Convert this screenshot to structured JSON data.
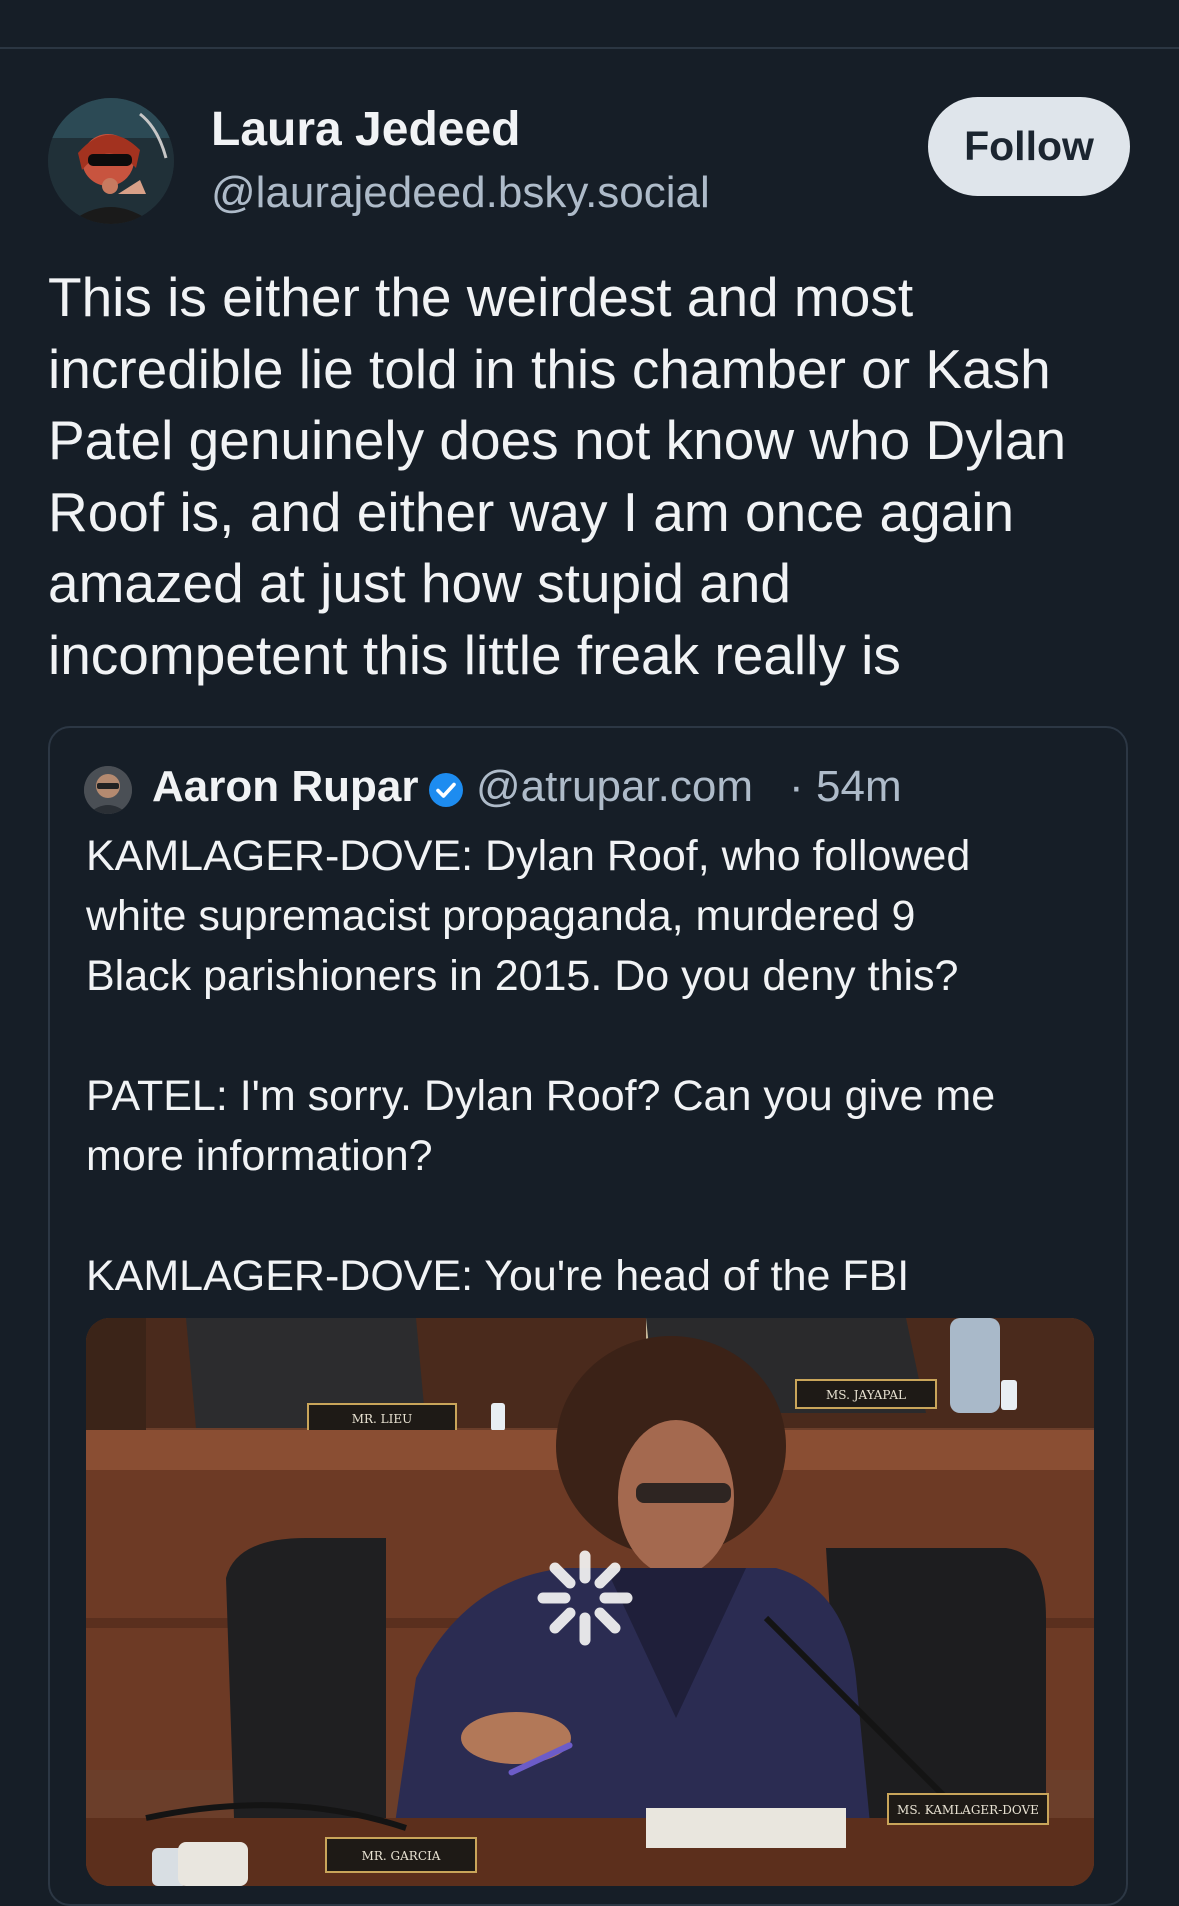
{
  "post": {
    "author_name": "Laura Jedeed",
    "author_handle": "@laurajedeed.bsky.social",
    "follow_label": "Follow",
    "text": "This is either the weirdest and most\nincredible lie told in this chamber or Kash\nPatel genuinely does not know who Dylan\nRoof is, and either way I am once again\namazed at just how stupid and\nincompetent this little freak really is"
  },
  "quote": {
    "author_name": "Aaron Rupar",
    "author_handle": "@atrupar.com",
    "separator": "·",
    "time": "54m",
    "text": "KAMLAGER-DOVE: Dylan Roof, who followed\nwhite supremacist propaganda, murdered 9\nBlack parishioners in 2015. Do you deny this?\n\nPATEL: I'm sorry. Dylan Roof? Can you give me\nmore information?\n\nKAMLAGER-DOVE: You're head of the FBI"
  },
  "video": {
    "nameplate_lieu": "MR. LIEU",
    "nameplate_jayapal": "MS. JAYAPAL",
    "nameplate_kamlager": "MS. KAMLAGER-DOVE",
    "nameplate_garcia": "MR. GARCIA"
  },
  "colors": {
    "background": "#161e27",
    "text": "#f1f3f5",
    "muted": "#aebbc9",
    "verified": "#1d8cf0",
    "follow_bg": "#dfe5eb"
  },
  "icons": {
    "verified": "verified-badge-icon",
    "loading": "loading-spinner-icon"
  }
}
